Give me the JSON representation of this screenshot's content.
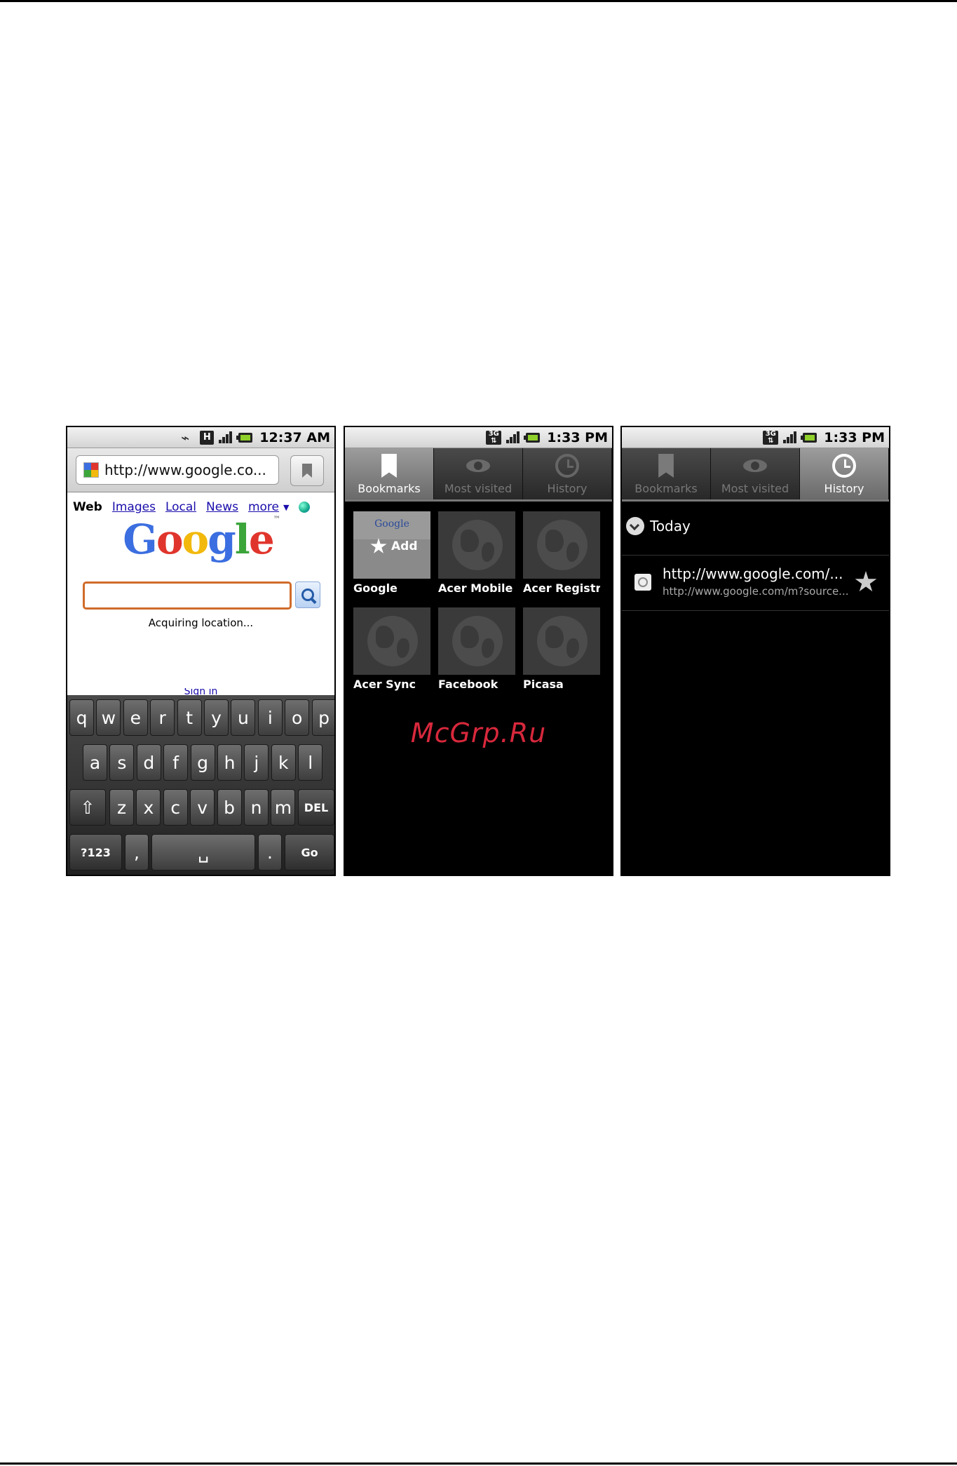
{
  "phone1": {
    "status_time": "12:37 AM",
    "url": "http://www.google.co...",
    "nav": {
      "web": "Web",
      "images": "Images",
      "local": "Local",
      "news": "News",
      "more": "more"
    },
    "logo": "Google",
    "search_value": "",
    "status_message": "Acquiring location...",
    "sign_in": "Sign in",
    "keyboard": {
      "row1": [
        "q",
        "w",
        "e",
        "r",
        "t",
        "y",
        "u",
        "i",
        "o",
        "p"
      ],
      "row2": [
        "a",
        "s",
        "d",
        "f",
        "g",
        "h",
        "j",
        "k",
        "l"
      ],
      "row3": [
        "z",
        "x",
        "c",
        "v",
        "b",
        "n",
        "m"
      ],
      "shift": "⇧",
      "del": "DEL",
      "sym": "?123",
      "comma": ",",
      "space": "␣",
      "period": ".",
      "go": "Go"
    }
  },
  "phone2": {
    "status_time": "1:33 PM",
    "tabs": [
      "Bookmarks",
      "Most visited",
      "History"
    ],
    "add_label": "Add",
    "add_mini_logo": "Google",
    "bookmarks": [
      "Google",
      "Acer Mobile",
      "Acer Registra",
      "Acer Sync",
      "Facebook",
      "Picasa"
    ],
    "watermark": "McGrp.Ru"
  },
  "phone3": {
    "status_time": "1:33 PM",
    "tabs": [
      "Bookmarks",
      "Most visited",
      "History"
    ],
    "group_label": "Today",
    "history_items": [
      {
        "title": "http://www.google.com/...",
        "url": "http://www.google.com/m?source..."
      }
    ]
  }
}
